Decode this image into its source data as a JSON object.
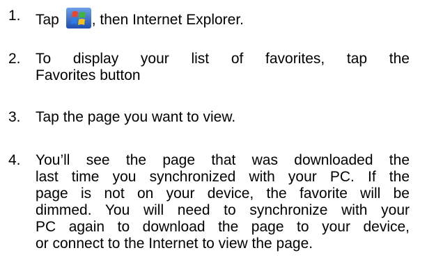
{
  "steps": [
    {
      "number": "1.",
      "text_before_icon": "Tap ",
      "icon": "windows-start-icon",
      "text_after_icon": ", then Internet Explorer."
    },
    {
      "number": "2.",
      "lines": [
        "To display your list of favorites, tap the",
        "Favorites button"
      ]
    },
    {
      "number": "3.",
      "text": "Tap the page you want to view."
    },
    {
      "number": "4.",
      "lines": [
        "You’ll see the page that was downloaded the",
        "last time you synchronized with your PC. If the",
        "page is not on your device, the favorite will be",
        "dimmed. You will need to synchronize with your",
        "PC again to download the page to your device,",
        "or connect to the Internet to view the page."
      ]
    }
  ],
  "colors": {
    "text": "#000000",
    "background": "#ffffff"
  }
}
